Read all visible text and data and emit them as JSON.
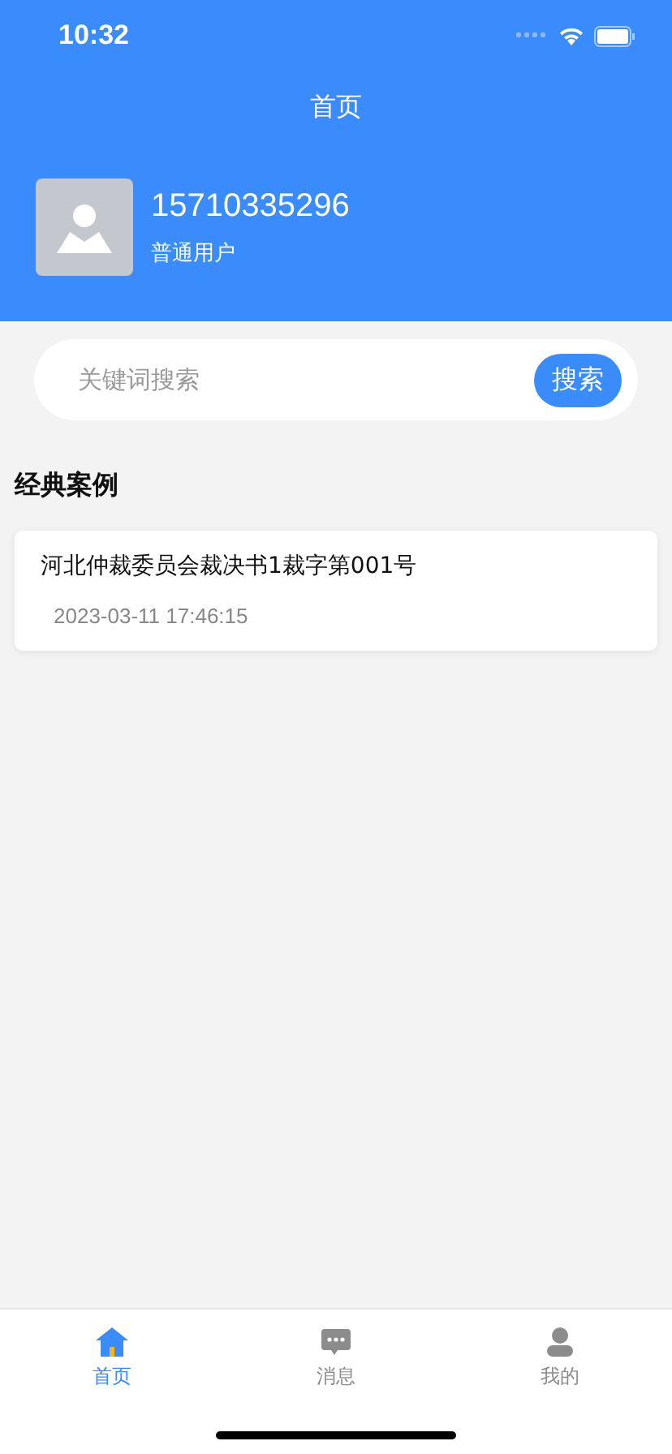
{
  "status_bar": {
    "time": "10:32"
  },
  "header": {
    "title": "首页"
  },
  "profile": {
    "phone": "15710335296",
    "role": "普通用户"
  },
  "search": {
    "placeholder": "关键词搜索",
    "button": "搜索"
  },
  "section": {
    "title": "经典案例"
  },
  "cases": [
    {
      "title": "河北仲裁委员会裁决书1裁字第001号",
      "time": "2023-03-11 17:46:15"
    }
  ],
  "tabs": [
    {
      "kind": "home",
      "label": "首页",
      "selected": true
    },
    {
      "kind": "message",
      "label": "消息",
      "selected": false
    },
    {
      "kind": "profile",
      "label": "我的",
      "selected": false
    }
  ]
}
